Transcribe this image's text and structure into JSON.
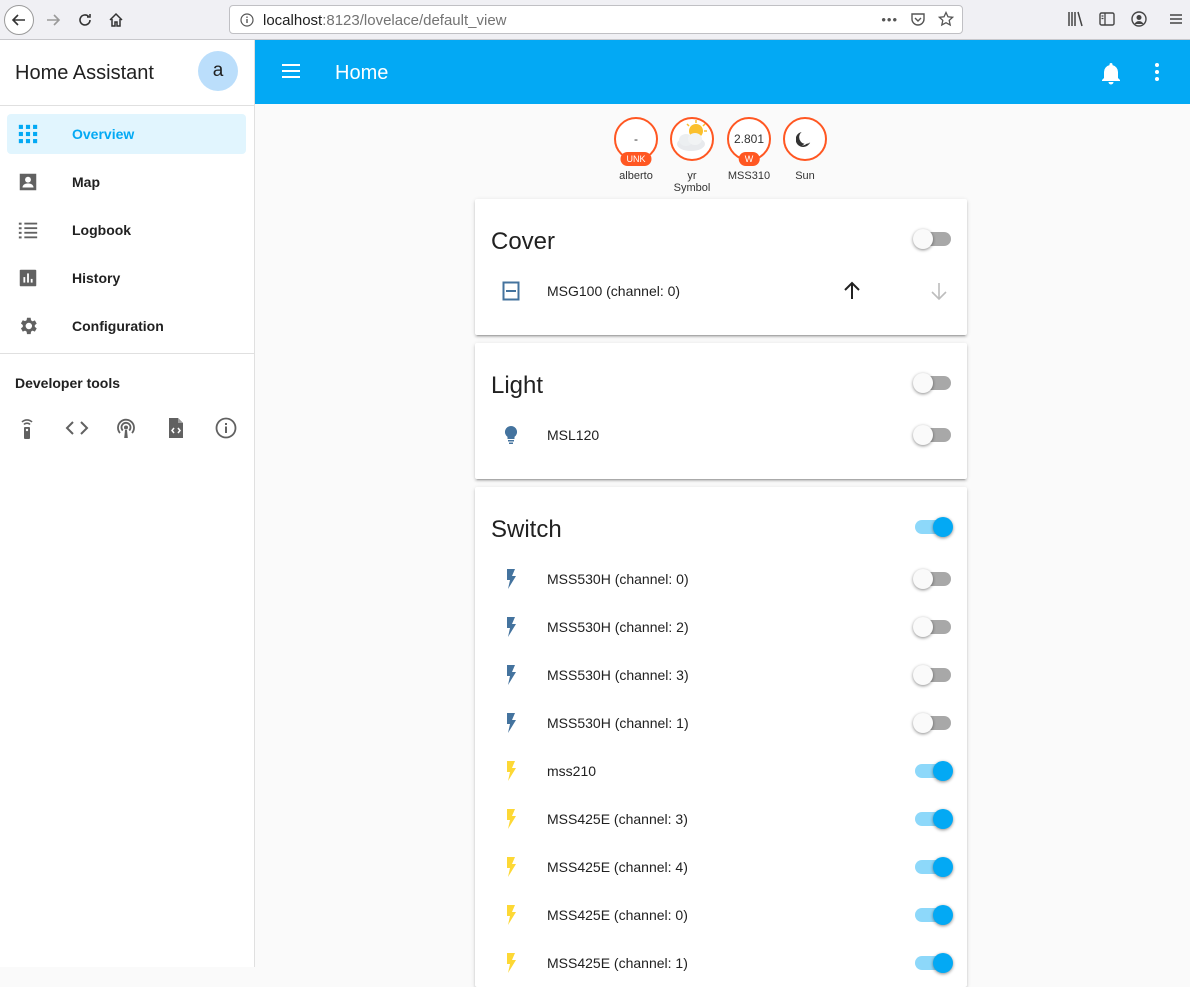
{
  "browser": {
    "url_host": "localhost",
    "url_rest": ":8123/lovelace/default_view",
    "url_dots": "•••"
  },
  "sidebar": {
    "title": "Home Assistant",
    "avatar_letter": "a",
    "items": [
      {
        "label": "Overview",
        "icon": "grid-icon",
        "active": true
      },
      {
        "label": "Map",
        "icon": "account-box-icon",
        "active": false
      },
      {
        "label": "Logbook",
        "icon": "list-icon",
        "active": false
      },
      {
        "label": "History",
        "icon": "chart-icon",
        "active": false
      },
      {
        "label": "Configuration",
        "icon": "gear-icon",
        "active": false
      }
    ],
    "developer_tools_label": "Developer tools",
    "dev_icons": [
      "remote-icon",
      "code-icon",
      "podcast-icon",
      "file-code-icon",
      "info-icon"
    ]
  },
  "appbar": {
    "title": "Home"
  },
  "badges": [
    {
      "value": "-",
      "unit": "UNK",
      "label": "alberto"
    },
    {
      "value": "",
      "unit": "",
      "label": "yr Symbol"
    },
    {
      "value": "2.801",
      "unit": "W",
      "label": "MSS310"
    },
    {
      "value": "",
      "unit": "",
      "label": "Sun"
    }
  ],
  "cards": {
    "cover": {
      "title": "Cover",
      "toggle_on": false,
      "entities": [
        {
          "name": "MSG100 (channel: 0)"
        }
      ]
    },
    "light": {
      "title": "Light",
      "toggle_on": false,
      "entities": [
        {
          "name": "MSL120",
          "on": false
        }
      ]
    },
    "switch": {
      "title": "Switch",
      "toggle_on": true,
      "entities": [
        {
          "name": "MSS530H (channel: 0)",
          "on": false
        },
        {
          "name": "MSS530H (channel: 2)",
          "on": false
        },
        {
          "name": "MSS530H (channel: 3)",
          "on": false
        },
        {
          "name": "MSS530H (channel: 1)",
          "on": false
        },
        {
          "name": "mss210",
          "on": true
        },
        {
          "name": "MSS425E (channel: 3)",
          "on": true
        },
        {
          "name": "MSS425E (channel: 4)",
          "on": true
        },
        {
          "name": "MSS425E (channel: 0)",
          "on": true
        },
        {
          "name": "MSS425E (channel: 1)",
          "on": true
        }
      ]
    }
  },
  "colors": {
    "primary": "#03a9f4",
    "badge_border": "#ff5722",
    "icon_off": "#44739e",
    "icon_on": "#fdd835"
  }
}
